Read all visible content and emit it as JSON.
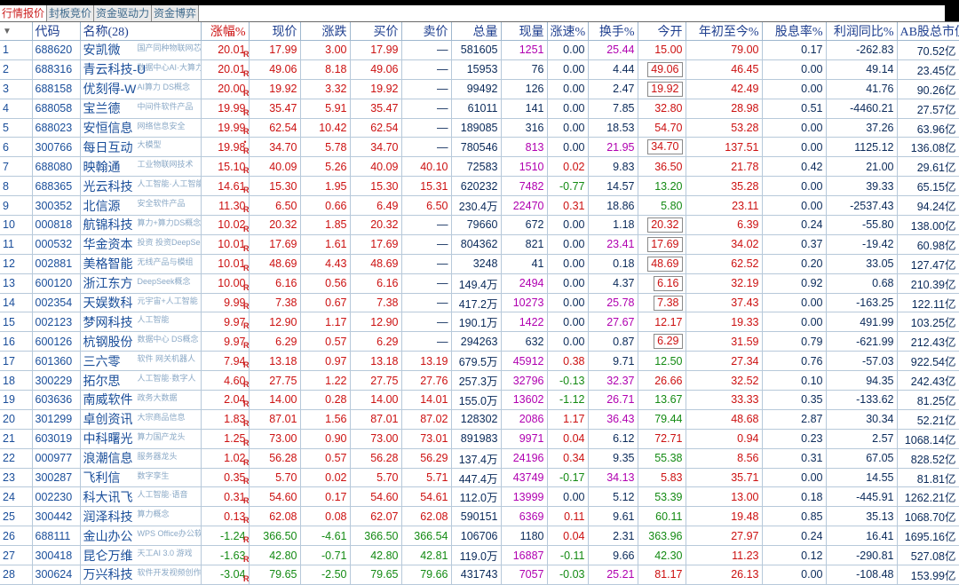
{
  "tabs": [
    "行情报价",
    "封板竞价",
    "资金驱动力",
    "资金博弈"
  ],
  "headers": {
    "zf": "涨幅%",
    "price": "现价",
    "chg": "涨跌",
    "bid": "买价",
    "ask": "卖价",
    "vol": "总量",
    "cur": "现量",
    "spd": "涨速%",
    "turn": "换手%",
    "open": "今开",
    "ytd": "年初至今%",
    "div": "股息率%",
    "profit": "利润同比%",
    "mcap": "AB股总市值",
    "code": "代码",
    "name": "名称(28)"
  },
  "colors": {
    "up": "#cc1111",
    "down": "#138a13",
    "neutral": "#0a2a5a",
    "purple": "#b000b0",
    "link": "#1a4e9a"
  },
  "rows": [
    {
      "idx": "1",
      "code": "688620",
      "name": "安凯微",
      "tag": "国产同种物联网芯片Soc",
      "dot": false,
      "zf": "20.01",
      "price": "17.99",
      "chg": "3.00",
      "bid": "17.99",
      "ask": "—",
      "vol": "581605",
      "cur": "1251",
      "spd": "0.00",
      "turn": "25.44",
      "open": "15.00",
      "ytd": "79.00",
      "div": "0.17",
      "profit": "-262.83",
      "mcap": "70.52亿",
      "dir": "up",
      "openDir": "up",
      "openBox": false,
      "curColor": "pur",
      "turnColor": "pur"
    },
    {
      "idx": "2",
      "code": "688316",
      "name": "青云科技-U",
      "tag": "数据中心AI·大算力",
      "dot": false,
      "zf": "20.01",
      "price": "49.06",
      "chg": "8.18",
      "bid": "49.06",
      "ask": "—",
      "vol": "15953",
      "cur": "76",
      "spd": "0.00",
      "turn": "4.44",
      "open": "49.06",
      "ytd": "46.45",
      "div": "0.00",
      "profit": "49.14",
      "mcap": "23.45亿",
      "dir": "up",
      "openDir": "up",
      "openBox": true,
      "curColor": "blk",
      "turnColor": "blk"
    },
    {
      "idx": "3",
      "code": "688158",
      "name": "优刻得-W",
      "tag": "AI算力 DS概念",
      "dot": false,
      "zf": "20.00",
      "price": "19.92",
      "chg": "3.32",
      "bid": "19.92",
      "ask": "—",
      "vol": "99492",
      "cur": "126",
      "spd": "0.00",
      "turn": "2.47",
      "open": "19.92",
      "ytd": "42.49",
      "div": "0.00",
      "profit": "41.76",
      "mcap": "90.26亿",
      "dir": "up",
      "openDir": "up",
      "openBox": true,
      "curColor": "blk",
      "turnColor": "blk"
    },
    {
      "idx": "4",
      "code": "688058",
      "name": "宝兰德",
      "tag": "中间件软件产品",
      "dot": false,
      "zf": "19.99",
      "price": "35.47",
      "chg": "5.91",
      "bid": "35.47",
      "ask": "—",
      "vol": "61011",
      "cur": "141",
      "spd": "0.00",
      "turn": "7.85",
      "open": "32.80",
      "ytd": "28.98",
      "div": "0.51",
      "profit": "-4460.21",
      "mcap": "27.57亿",
      "dir": "up",
      "openDir": "up",
      "openBox": false,
      "curColor": "blk",
      "turnColor": "blk"
    },
    {
      "idx": "5",
      "code": "688023",
      "name": "安恒信息",
      "tag": "网络信息安全",
      "dot": false,
      "zf": "19.99",
      "price": "62.54",
      "chg": "10.42",
      "bid": "62.54",
      "ask": "—",
      "vol": "189085",
      "cur": "316",
      "spd": "0.00",
      "turn": "18.53",
      "open": "54.70",
      "ytd": "53.28",
      "div": "0.00",
      "profit": "37.26",
      "mcap": "63.96亿",
      "dir": "up",
      "openDir": "up",
      "openBox": false,
      "curColor": "blk",
      "turnColor": "blk"
    },
    {
      "idx": "6",
      "code": "300766",
      "name": "每日互动",
      "tag": "大模型",
      "dot": true,
      "zf": "19.98",
      "price": "34.70",
      "chg": "5.78",
      "bid": "34.70",
      "ask": "—",
      "vol": "780546",
      "cur": "813",
      "spd": "0.00",
      "turn": "21.95",
      "open": "34.70",
      "ytd": "137.51",
      "div": "0.00",
      "profit": "1125.12",
      "mcap": "136.08亿",
      "dir": "up",
      "openDir": "up",
      "openBox": true,
      "curColor": "pur",
      "turnColor": "pur"
    },
    {
      "idx": "7",
      "code": "688080",
      "name": "映翰通",
      "tag": "工业物联网技术",
      "dot": false,
      "zf": "15.10",
      "price": "40.09",
      "chg": "5.26",
      "bid": "40.09",
      "ask": "40.10",
      "vol": "72583",
      "cur": "1510",
      "spd": "0.02",
      "turn": "9.83",
      "open": "36.50",
      "ytd": "21.78",
      "div": "0.42",
      "profit": "21.00",
      "mcap": "29.61亿",
      "dir": "up",
      "openDir": "up",
      "openBox": false,
      "curColor": "pur",
      "turnColor": "blk"
    },
    {
      "idx": "8",
      "code": "688365",
      "name": "光云科技",
      "tag": "人工智能·人工智能",
      "dot": false,
      "zf": "14.61",
      "price": "15.30",
      "chg": "1.95",
      "bid": "15.30",
      "ask": "15.31",
      "vol": "620232",
      "cur": "7482",
      "spd": "-0.77",
      "turn": "14.57",
      "open": "13.20",
      "ytd": "35.28",
      "div": "0.00",
      "profit": "39.33",
      "mcap": "65.15亿",
      "dir": "up",
      "openDir": "dn",
      "openBox": false,
      "curColor": "pur",
      "turnColor": "blk"
    },
    {
      "idx": "9",
      "code": "300352",
      "name": "北信源",
      "tag": "安全软件产品",
      "dot": false,
      "zf": "11.30",
      "price": "6.50",
      "chg": "0.66",
      "bid": "6.49",
      "ask": "6.50",
      "vol": "230.4万",
      "cur": "22470",
      "spd": "0.31",
      "turn": "18.86",
      "open": "5.80",
      "ytd": "23.11",
      "div": "0.00",
      "profit": "-2537.43",
      "mcap": "94.24亿",
      "dir": "up",
      "openDir": "dn",
      "openBox": false,
      "curColor": "pur",
      "turnColor": "blk"
    },
    {
      "idx": "10",
      "code": "000818",
      "name": "航锦科技",
      "tag": "算力+算力DS概念",
      "dot": false,
      "zf": "10.02",
      "price": "20.32",
      "chg": "1.85",
      "bid": "20.32",
      "ask": "—",
      "vol": "79660",
      "cur": "672",
      "spd": "0.00",
      "turn": "1.18",
      "open": "20.32",
      "ytd": "6.39",
      "div": "0.24",
      "profit": "-55.80",
      "mcap": "138.00亿",
      "dir": "up",
      "openDir": "up",
      "openBox": true,
      "curColor": "blk",
      "turnColor": "blk"
    },
    {
      "idx": "11",
      "code": "000532",
      "name": "华金资本",
      "tag": "投资 投资DeepSeek",
      "dot": false,
      "zf": "10.01",
      "price": "17.69",
      "chg": "1.61",
      "bid": "17.69",
      "ask": "—",
      "vol": "804362",
      "cur": "821",
      "spd": "0.00",
      "turn": "23.41",
      "open": "17.69",
      "ytd": "34.02",
      "div": "0.37",
      "profit": "-19.42",
      "mcap": "60.98亿",
      "dir": "up",
      "openDir": "up",
      "openBox": true,
      "curColor": "blk",
      "turnColor": "pur"
    },
    {
      "idx": "12",
      "code": "002881",
      "name": "美格智能",
      "tag": "无线产品与模组",
      "dot": false,
      "zf": "10.01",
      "price": "48.69",
      "chg": "4.43",
      "bid": "48.69",
      "ask": "—",
      "vol": "3248",
      "cur": "41",
      "spd": "0.00",
      "turn": "0.18",
      "open": "48.69",
      "ytd": "62.52",
      "div": "0.20",
      "profit": "33.05",
      "mcap": "127.47亿",
      "dir": "up",
      "openDir": "up",
      "openBox": true,
      "curColor": "blk",
      "turnColor": "blk"
    },
    {
      "idx": "13",
      "code": "600120",
      "name": "浙江东方",
      "tag": "DeepSeek概念",
      "dot": false,
      "zf": "10.00",
      "price": "6.16",
      "chg": "0.56",
      "bid": "6.16",
      "ask": "—",
      "vol": "149.4万",
      "cur": "2494",
      "spd": "0.00",
      "turn": "4.37",
      "open": "6.16",
      "ytd": "32.19",
      "div": "0.92",
      "profit": "0.68",
      "mcap": "210.39亿",
      "dir": "up",
      "openDir": "up",
      "openBox": true,
      "curColor": "pur",
      "turnColor": "blk"
    },
    {
      "idx": "14",
      "code": "002354",
      "name": "天娱数科",
      "tag": "元宇宙+人工智能",
      "dot": false,
      "zf": "9.99",
      "price": "7.38",
      "chg": "0.67",
      "bid": "7.38",
      "ask": "—",
      "vol": "417.2万",
      "cur": "10273",
      "spd": "0.00",
      "turn": "25.78",
      "open": "7.38",
      "ytd": "37.43",
      "div": "0.00",
      "profit": "-163.25",
      "mcap": "122.11亿",
      "dir": "up",
      "openDir": "up",
      "openBox": true,
      "curColor": "pur",
      "turnColor": "pur"
    },
    {
      "idx": "15",
      "code": "002123",
      "name": "梦网科技",
      "tag": "人工智能",
      "dot": false,
      "zf": "9.97",
      "price": "12.90",
      "chg": "1.17",
      "bid": "12.90",
      "ask": "—",
      "vol": "190.1万",
      "cur": "1422",
      "spd": "0.00",
      "turn": "27.67",
      "open": "12.17",
      "ytd": "19.33",
      "div": "0.00",
      "profit": "491.99",
      "mcap": "103.25亿",
      "dir": "up",
      "openDir": "up",
      "openBox": false,
      "curColor": "pur",
      "turnColor": "pur"
    },
    {
      "idx": "16",
      "code": "600126",
      "name": "杭钢股份",
      "tag": "数据中心 DS概念",
      "dot": false,
      "zf": "9.97",
      "price": "6.29",
      "chg": "0.57",
      "bid": "6.29",
      "ask": "—",
      "vol": "294263",
      "cur": "632",
      "spd": "0.00",
      "turn": "0.87",
      "open": "6.29",
      "ytd": "31.59",
      "div": "0.79",
      "profit": "-621.99",
      "mcap": "212.43亿",
      "dir": "up",
      "openDir": "up",
      "openBox": true,
      "curColor": "blk",
      "turnColor": "blk"
    },
    {
      "idx": "17",
      "code": "601360",
      "name": "三六零",
      "tag": "软件 网关机器人",
      "dot": false,
      "zf": "7.94",
      "price": "13.18",
      "chg": "0.97",
      "bid": "13.18",
      "ask": "13.19",
      "vol": "679.5万",
      "cur": "45912",
      "spd": "0.38",
      "turn": "9.71",
      "open": "12.50",
      "ytd": "27.34",
      "div": "0.76",
      "profit": "-57.03",
      "mcap": "922.54亿",
      "dir": "up",
      "openDir": "dn",
      "openBox": false,
      "curColor": "pur",
      "turnColor": "blk"
    },
    {
      "idx": "18",
      "code": "300229",
      "name": "拓尔思",
      "tag": "人工智能·数字人",
      "dot": false,
      "zf": "4.60",
      "price": "27.75",
      "chg": "1.22",
      "bid": "27.75",
      "ask": "27.76",
      "vol": "257.3万",
      "cur": "32796",
      "spd": "-0.13",
      "turn": "32.37",
      "open": "26.66",
      "ytd": "32.52",
      "div": "0.10",
      "profit": "94.35",
      "mcap": "242.43亿",
      "dir": "up",
      "openDir": "up",
      "openBox": false,
      "curColor": "pur",
      "turnColor": "pur"
    },
    {
      "idx": "19",
      "code": "603636",
      "name": "南威软件",
      "tag": "政务大数据",
      "dot": false,
      "zf": "2.04",
      "price": "14.00",
      "chg": "0.28",
      "bid": "14.00",
      "ask": "14.01",
      "vol": "155.0万",
      "cur": "13602",
      "spd": "-1.12",
      "turn": "26.71",
      "open": "13.67",
      "ytd": "33.33",
      "div": "0.35",
      "profit": "-133.62",
      "mcap": "81.25亿",
      "dir": "up",
      "openDir": "dn",
      "openBox": false,
      "curColor": "pur",
      "turnColor": "pur"
    },
    {
      "idx": "20",
      "code": "301299",
      "name": "卓创资讯",
      "tag": "大宗商品信息",
      "dot": false,
      "zf": "1.83",
      "price": "87.01",
      "chg": "1.56",
      "bid": "87.01",
      "ask": "87.02",
      "vol": "128302",
      "cur": "2086",
      "spd": "1.17",
      "turn": "36.43",
      "open": "79.44",
      "ytd": "48.68",
      "div": "2.87",
      "profit": "30.34",
      "mcap": "52.21亿",
      "dir": "up",
      "openDir": "dn",
      "openBox": false,
      "curColor": "pur",
      "turnColor": "pur"
    },
    {
      "idx": "21",
      "code": "603019",
      "name": "中科曙光",
      "tag": "算力国产龙头",
      "dot": false,
      "zf": "1.25",
      "price": "73.00",
      "chg": "0.90",
      "bid": "73.00",
      "ask": "73.01",
      "vol": "891983",
      "cur": "9971",
      "spd": "0.04",
      "turn": "6.12",
      "open": "72.71",
      "ytd": "0.94",
      "div": "0.23",
      "profit": "2.57",
      "mcap": "1068.14亿",
      "dir": "up",
      "openDir": "up",
      "openBox": false,
      "curColor": "pur",
      "turnColor": "blk"
    },
    {
      "idx": "22",
      "code": "000977",
      "name": "浪潮信息",
      "tag": "服务器龙头",
      "dot": false,
      "zf": "1.02",
      "price": "56.28",
      "chg": "0.57",
      "bid": "56.28",
      "ask": "56.29",
      "vol": "137.4万",
      "cur": "24196",
      "spd": "0.34",
      "turn": "9.35",
      "open": "55.38",
      "ytd": "8.56",
      "div": "0.31",
      "profit": "67.05",
      "mcap": "828.52亿",
      "dir": "up",
      "openDir": "dn",
      "openBox": false,
      "curColor": "pur",
      "turnColor": "blk"
    },
    {
      "idx": "23",
      "code": "300287",
      "name": "飞利信",
      "tag": "数字孪生",
      "dot": false,
      "zf": "0.35",
      "price": "5.70",
      "chg": "0.02",
      "bid": "5.70",
      "ask": "5.71",
      "vol": "447.4万",
      "cur": "43749",
      "spd": "-0.17",
      "turn": "34.13",
      "open": "5.83",
      "ytd": "35.71",
      "div": "0.00",
      "profit": "14.55",
      "mcap": "81.81亿",
      "dir": "up",
      "openDir": "up",
      "openBox": false,
      "curColor": "pur",
      "turnColor": "pur"
    },
    {
      "idx": "24",
      "code": "002230",
      "name": "科大讯飞",
      "tag": "人工智能·语音",
      "dot": false,
      "zf": "0.31",
      "price": "54.60",
      "chg": "0.17",
      "bid": "54.60",
      "ask": "54.61",
      "vol": "112.0万",
      "cur": "13999",
      "spd": "0.00",
      "turn": "5.12",
      "open": "53.39",
      "ytd": "13.00",
      "div": "0.18",
      "profit": "-445.91",
      "mcap": "1262.21亿",
      "dir": "up",
      "openDir": "dn",
      "openBox": false,
      "curColor": "pur",
      "turnColor": "blk"
    },
    {
      "idx": "25",
      "code": "300442",
      "name": "润泽科技",
      "tag": "算力概念",
      "dot": false,
      "zf": "0.13",
      "price": "62.08",
      "chg": "0.08",
      "bid": "62.07",
      "ask": "62.08",
      "vol": "590151",
      "cur": "6369",
      "spd": "0.11",
      "turn": "9.61",
      "open": "60.11",
      "ytd": "19.48",
      "div": "0.85",
      "profit": "35.13",
      "mcap": "1068.70亿",
      "dir": "up",
      "openDir": "dn",
      "openBox": false,
      "curColor": "pur",
      "turnColor": "blk"
    },
    {
      "idx": "26",
      "code": "688111",
      "name": "金山办公",
      "tag": "WPS Office办公软件",
      "dot": false,
      "zf": "-1.24",
      "price": "366.50",
      "chg": "-4.61",
      "bid": "366.50",
      "ask": "366.54",
      "vol": "106706",
      "cur": "1180",
      "spd": "0.04",
      "turn": "2.31",
      "open": "363.96",
      "ytd": "27.97",
      "div": "0.24",
      "profit": "16.41",
      "mcap": "1695.16亿",
      "dir": "dn",
      "openDir": "dn",
      "openBox": false,
      "curColor": "blk",
      "turnColor": "blk"
    },
    {
      "idx": "27",
      "code": "300418",
      "name": "昆仑万维",
      "tag": "天工AI 3.0 游戏",
      "dot": false,
      "zf": "-1.63",
      "price": "42.80",
      "chg": "-0.71",
      "bid": "42.80",
      "ask": "42.81",
      "vol": "119.0万",
      "cur": "16887",
      "spd": "-0.11",
      "turn": "9.66",
      "open": "42.30",
      "ytd": "11.23",
      "div": "0.12",
      "profit": "-290.81",
      "mcap": "527.08亿",
      "dir": "dn",
      "openDir": "dn",
      "openBox": false,
      "curColor": "pur",
      "turnColor": "blk"
    },
    {
      "idx": "28",
      "code": "300624",
      "name": "万兴科技",
      "tag": "软件开发视频创作",
      "dot": false,
      "zf": "-3.04",
      "price": "79.65",
      "chg": "-2.50",
      "bid": "79.65",
      "ask": "79.66",
      "vol": "431743",
      "cur": "7057",
      "spd": "-0.03",
      "turn": "25.21",
      "open": "81.17",
      "ytd": "26.13",
      "div": "0.00",
      "profit": "-108.48",
      "mcap": "153.99亿",
      "dir": "dn",
      "openDir": "up",
      "openBox": false,
      "curColor": "pur",
      "turnColor": "pur"
    }
  ]
}
